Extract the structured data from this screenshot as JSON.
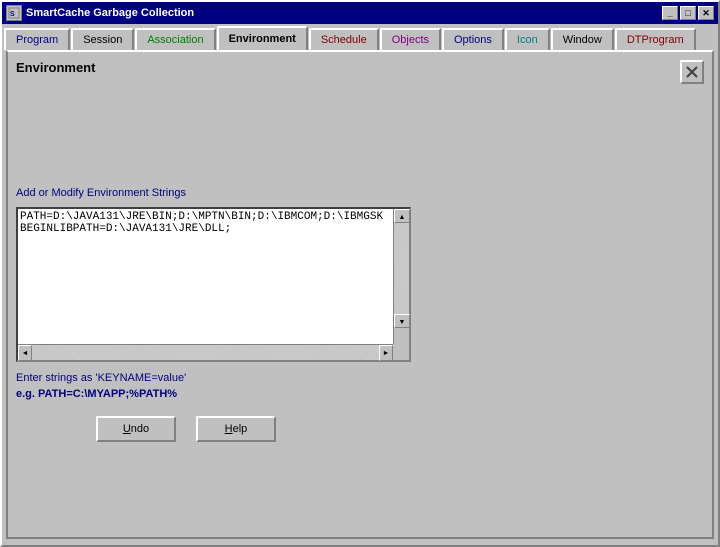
{
  "window": {
    "title": "SmartCache Garbage Collection",
    "icon_label": "SC"
  },
  "title_bar": {
    "title": "SmartCache Garbage Collection",
    "close_label": "✕",
    "maximize_label": "□",
    "minimize_label": "_"
  },
  "tabs": [
    {
      "id": "program",
      "label": "Program",
      "active": false
    },
    {
      "id": "session",
      "label": "Session",
      "active": false
    },
    {
      "id": "association",
      "label": "Association",
      "active": false
    },
    {
      "id": "environment",
      "label": "Environment",
      "active": true
    },
    {
      "id": "schedule",
      "label": "Schedule",
      "active": false
    },
    {
      "id": "objects",
      "label": "Objects",
      "active": false
    },
    {
      "id": "options",
      "label": "Options",
      "active": false
    },
    {
      "id": "icon",
      "label": "Icon",
      "active": false
    },
    {
      "id": "window",
      "label": "Window",
      "active": false
    },
    {
      "id": "dtprogram",
      "label": "DTProgram",
      "active": false
    }
  ],
  "panel": {
    "title": "Environment"
  },
  "content": {
    "section_label": "Add or Modify Environment Strings",
    "env_text": "PATH=D:\\JAVA131\\JRE\\BIN;D:\\MPTN\\BIN;D:\\IBMCOM;D:\\IBMGSK\nBEGINLIBPATH=D:\\JAVA131\\JRE\\DLL;",
    "hint1": "Enter strings as 'KEYNAME=value'",
    "hint2": "e.g. PATH=C:\\MYAPP;%PATH%"
  },
  "buttons": {
    "undo_label": "Undo",
    "help_label": "Help"
  }
}
